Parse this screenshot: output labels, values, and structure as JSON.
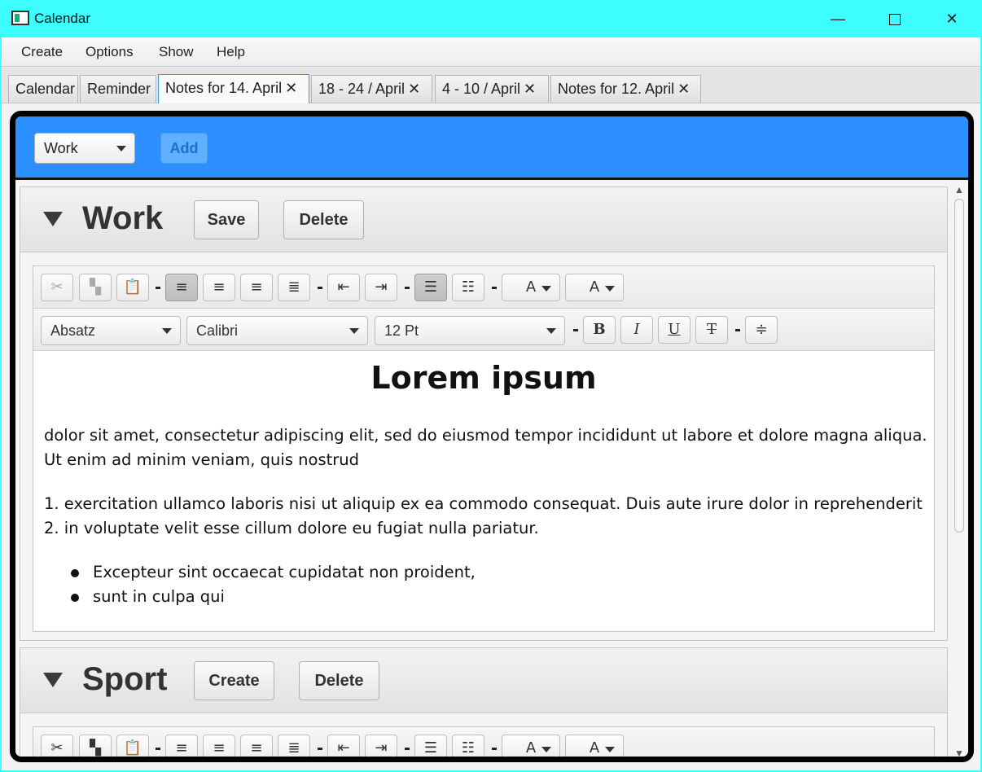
{
  "window": {
    "title": "Calendar",
    "controls": {
      "minimize": "—",
      "close": "✕"
    }
  },
  "menu": [
    "Create",
    "Options",
    "Show",
    "Help"
  ],
  "tabs": [
    {
      "label": "Calendar",
      "closable": false
    },
    {
      "label": "Reminder",
      "closable": false
    },
    {
      "label": "Notes for 14. April",
      "closable": true,
      "active": true
    },
    {
      "label": "18 - 24 / April",
      "closable": true
    },
    {
      "label": "4 - 10 / April",
      "closable": true
    },
    {
      "label": "Notes for 12. April",
      "closable": true
    }
  ],
  "tab_close_glyph": "✕",
  "topbar": {
    "category_value": "Work",
    "add_label": "Add",
    "accent_color": "#2b8fff"
  },
  "sections": [
    {
      "title": "Work",
      "primary_label": "Save",
      "delete_label": "Delete",
      "toolbar": {
        "paragraph": "Absatz",
        "font": "Calibri",
        "size": "12 Pt",
        "bold": "B",
        "italic": "I",
        "underline": "U",
        "strike": "T"
      },
      "document": {
        "heading": "Lorem ipsum",
        "paragraph1_line1": "dolor sit amet, consectetur adipiscing elit, sed do eiusmod tempor incididunt ut labore et dolore magna aliqua.",
        "paragraph1_line2": "Ut enim ad minim veniam, quis nostrud",
        "numbered": [
          "1. exercitation ullamco laboris nisi ut aliquip ex ea commodo consequat. Duis aute irure dolor in reprehenderit",
          "2. in voluptate velit esse cillum dolore eu fugiat nulla pariatur."
        ],
        "bullets": [
          "Excepteur sint occaecat cupidatat non proident,",
          "sunt in culpa qui"
        ]
      }
    },
    {
      "title": "Sport",
      "primary_label": "Create",
      "delete_label": "Delete"
    }
  ],
  "icons": {
    "cut": "✂",
    "copy": "▚",
    "paste": "📋",
    "align_left": "≡",
    "align_center": "≡",
    "align_right": "≡",
    "justify": "≣",
    "outdent": "⇤",
    "indent": "⇥",
    "bullets": "☰",
    "numbers": "☷",
    "text_color": "A",
    "bg_color": "A"
  }
}
